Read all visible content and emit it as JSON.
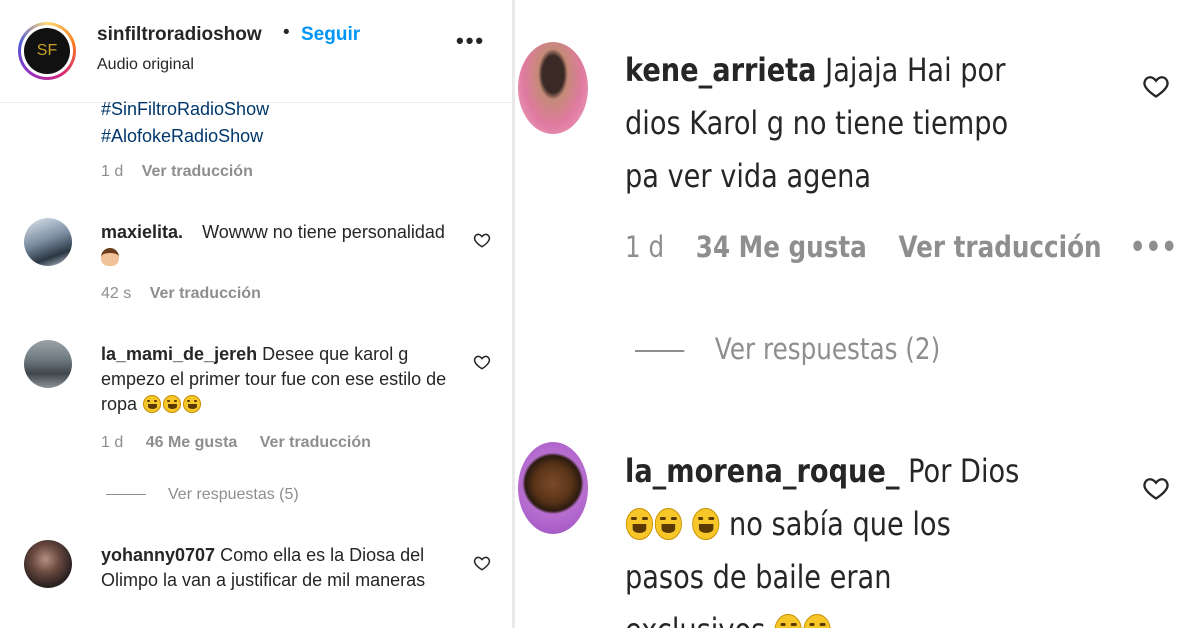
{
  "header": {
    "username": "sinfiltroradioshow",
    "dot": "•",
    "follow_label": "Seguir",
    "subtitle": "Audio original",
    "more": "•••",
    "logo_text": "SF"
  },
  "caption": {
    "hashtags": [
      "#SinFiltroRadioShow",
      "#AlofokeRadioShow"
    ],
    "time": "1 d",
    "translate": "Ver traducción"
  },
  "comments": [
    {
      "username": "maxielita.",
      "text": "Wowww no tiene personalidad",
      "time": "42 s",
      "translate": "Ver traducción"
    },
    {
      "username": "la_mami_de_jereh",
      "text": "Desee que karol g empezo el primer tour fue con ese estilo de ropa",
      "time": "1 d",
      "likes": "46 Me gusta",
      "translate": "Ver traducción",
      "replies": "Ver respuestas (5)"
    },
    {
      "username": "yohanny0707",
      "text": "Como ella es la Diosa del Olimpo la van a justificar de mil maneras"
    }
  ],
  "zoom": [
    {
      "username": "kene_arrieta",
      "text": "Jajaja Hai por dios Karol g no tiene tiempo pa ver vida agena",
      "time": "1 d",
      "likes": "34 Me gusta",
      "translate": "Ver traducción",
      "more": "•••",
      "replies": "Ver respuestas (2)"
    },
    {
      "username": "la_morena_roque_",
      "text_a": "Por Dios",
      "text_b": "no sabía que los pasos de baile",
      "text_c": "eran exclusivos"
    }
  ],
  "colors": {
    "link": "#0095f6",
    "hashtag": "#00376b",
    "muted": "#8e8e8e",
    "text": "#262626"
  },
  "icons": [
    "heart-icon",
    "more-icon",
    "laughing-emoji",
    "facepalm-emoji"
  ]
}
